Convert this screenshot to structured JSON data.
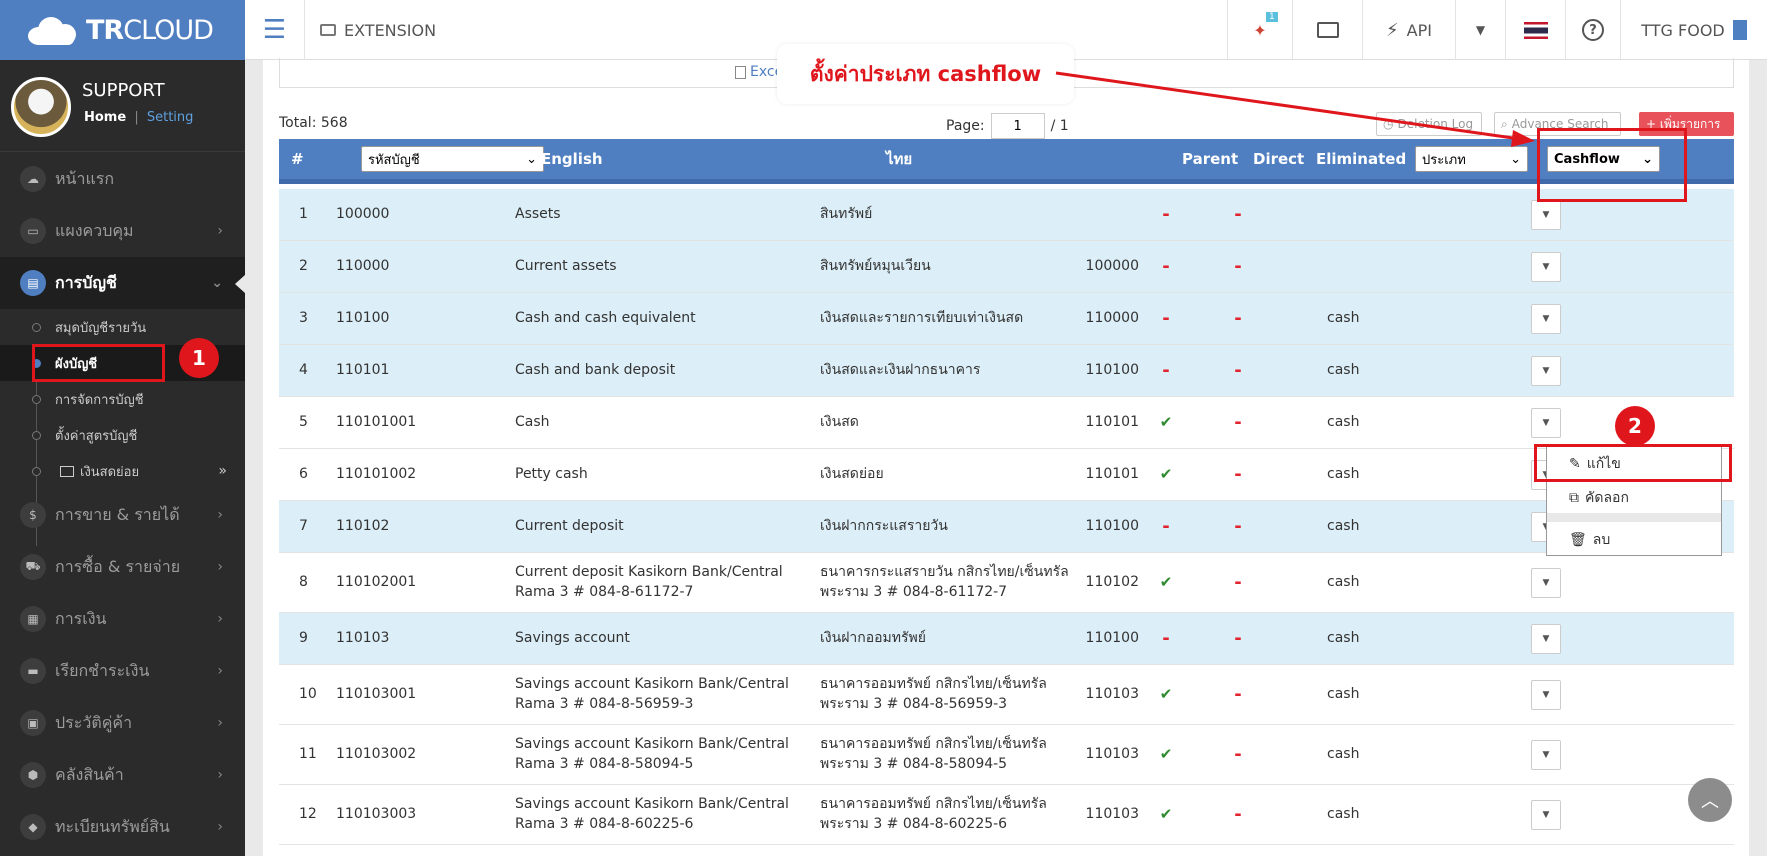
{
  "topbar": {
    "brand_bold": "TR",
    "brand_light": "CLOUD",
    "extension_label": "EXTENSION",
    "notification_count": "1",
    "api_label": "API",
    "company_label": "TTG FOOD"
  },
  "sidebar": {
    "user_name": "SUPPORT",
    "home_link": "Home",
    "separator": "|",
    "setting_link": "Setting",
    "items": [
      {
        "label": "หน้าแรก"
      },
      {
        "label": "แผงควบคุม"
      },
      {
        "label": "การบัญชี"
      },
      {
        "label": "การขาย & รายได้"
      },
      {
        "label": "การซื้อ & รายจ่าย"
      },
      {
        "label": "การเงิน"
      },
      {
        "label": "เรียกชำระเงิน"
      },
      {
        "label": "ประวัติคู่ค้า"
      },
      {
        "label": "คลังสินค้า"
      },
      {
        "label": "ทะเบียนทรัพย์สิน"
      }
    ],
    "subitems": [
      {
        "label": "สมุดบัญชีรายวัน"
      },
      {
        "label": "ผังบัญชี"
      },
      {
        "label": "การจัดการบัญชี"
      },
      {
        "label": "ตั้งค่าสูตรบัญชี"
      },
      {
        "label": "เงินสดย่อย"
      }
    ]
  },
  "content": {
    "excel_label": "Excel",
    "total_label": "Total:",
    "total_value": "568",
    "page_label": "Page:",
    "page_value": "1",
    "page_total": "/ 1",
    "deletion_log": "Deletion Log",
    "advance_search": "Advance Search",
    "add_item": "+ เพิ่มรายการ"
  },
  "table": {
    "headers": {
      "num": "#",
      "code_select": "รหัสบัญชี",
      "english": "English",
      "thai": "ไทย",
      "parent": "Parent",
      "direct": "Direct",
      "eliminated": "Eliminated",
      "type_select": "ประเภท",
      "cashflow_select": "Cashflow"
    },
    "rows": [
      {
        "n": "1",
        "code": "100000",
        "en": "Assets",
        "th": "สินทรัพย์",
        "parent": "",
        "direct": "-",
        "elim": "-",
        "type": ""
      },
      {
        "n": "2",
        "code": "110000",
        "en": "Current assets",
        "th": "สินทรัพย์หมุนเวียน",
        "parent": "100000",
        "direct": "-",
        "elim": "-",
        "type": ""
      },
      {
        "n": "3",
        "code": "110100",
        "en": "Cash and cash equivalent",
        "th": "เงินสดและรายการเทียบเท่าเงินสด",
        "parent": "110000",
        "direct": "-",
        "elim": "-",
        "type": "cash"
      },
      {
        "n": "4",
        "code": "110101",
        "en": "Cash and bank deposit",
        "th": "เงินสดและเงินฝากธนาคาร",
        "parent": "110100",
        "direct": "-",
        "elim": "-",
        "type": "cash"
      },
      {
        "n": "5",
        "code": "110101001",
        "en": "Cash",
        "th": "เงินสด",
        "parent": "110101",
        "direct": "✔",
        "elim": "-",
        "type": "cash"
      },
      {
        "n": "6",
        "code": "110101002",
        "en": "Petty cash",
        "th": "เงินสดย่อย",
        "parent": "110101",
        "direct": "✔",
        "elim": "-",
        "type": "cash"
      },
      {
        "n": "7",
        "code": "110102",
        "en": "Current deposit",
        "th": "เงินฝากกระแสรายวัน",
        "parent": "110100",
        "direct": "-",
        "elim": "-",
        "type": "cash"
      },
      {
        "n": "8",
        "code": "110102001",
        "en": "Current deposit Kasikorn Bank/Central Rama 3 # 084-8-61172-7",
        "th": "ธนาคารกระแสรายวัน กสิกรไทย/เซ็นทรัล พระราม 3 # 084-8-61172-7",
        "parent": "110102",
        "direct": "✔",
        "elim": "-",
        "type": "cash"
      },
      {
        "n": "9",
        "code": "110103",
        "en": "Savings account",
        "th": "เงินฝากออมทรัพย์",
        "parent": "110100",
        "direct": "-",
        "elim": "-",
        "type": "cash"
      },
      {
        "n": "10",
        "code": "110103001",
        "en": "Savings account Kasikorn Bank/Central Rama 3 # 084-8-56959-3",
        "th": "ธนาคารออมทรัพย์ กสิกรไทย/เซ็นทรัลพระราม 3 # 084-8-56959-3",
        "parent": "110103",
        "direct": "✔",
        "elim": "-",
        "type": "cash"
      },
      {
        "n": "11",
        "code": "110103002",
        "en": "Savings account Kasikorn Bank/Central Rama 3 # 084-8-58094-5",
        "th": "ธนาคารออมทรัพย์ กสิกรไทย/เซ็นทรัลพระราม 3 # 084-8-58094-5",
        "parent": "110103",
        "direct": "✔",
        "elim": "-",
        "type": "cash"
      },
      {
        "n": "12",
        "code": "110103003",
        "en": "Savings account Kasikorn Bank/Central Rama 3 # 084-8-60225-6",
        "th": "ธนาคารออมทรัพย์ กสิกรไทย/เซ็นทรัลพระราม 3 # 084-8-60225-6",
        "parent": "110103",
        "direct": "✔",
        "elim": "-",
        "type": "cash"
      }
    ]
  },
  "context_menu": {
    "edit": "แก้ไข",
    "copy": "คัดลอก",
    "delete": "ลบ"
  },
  "annotations": {
    "callout": "ตั้งค่าประเภท cashflow",
    "badge1": "1",
    "badge2": "2"
  },
  "colors": {
    "brand_blue": "#4f7ec1",
    "row_alt": "#dceef7",
    "annotation_red": "#e0161d"
  }
}
